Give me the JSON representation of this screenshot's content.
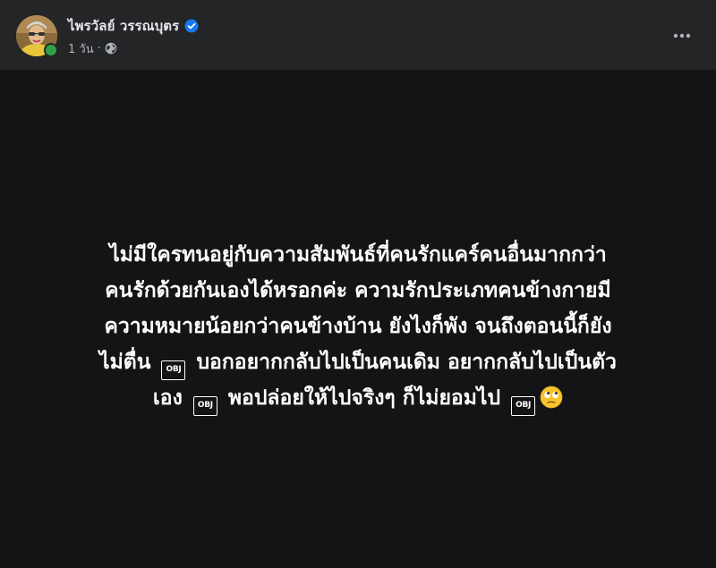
{
  "post": {
    "author": {
      "name": "ไพรวัลย์ วรรณบุตร",
      "verified": true,
      "online": true,
      "avatar_icon": "avatar-photo"
    },
    "meta": {
      "time": "1 วัน",
      "separator": "·",
      "audience_icon": "globe-icon"
    },
    "more_icon": "more-horizontal-icon",
    "body": {
      "background": "#141416",
      "lines": [
        {
          "parts": [
            {
              "type": "text",
              "value": "ไม่มีใครทนอยู่กับความสัมพันธ์ที่คนรักแคร์คนอื่นมากกว่า"
            }
          ]
        },
        {
          "parts": [
            {
              "type": "text",
              "value": "คนรักด้วยกันเองได้หรอกค่ะ ความรักประเภทคนข้างกายมี"
            }
          ]
        },
        {
          "parts": [
            {
              "type": "text",
              "value": "ความหมายน้อยกว่าคนข้างบ้าน ยังไงก็พัง จนถึงตอนนี้ก็ยัง"
            }
          ]
        },
        {
          "parts": [
            {
              "type": "text",
              "value": "ไม่ตื่น "
            },
            {
              "type": "obj",
              "value": "OBJ"
            },
            {
              "type": "text",
              "value": " บอกอยากกลับไปเป็นคนเดิม อยากกลับไปเป็นตัว"
            }
          ]
        },
        {
          "parts": [
            {
              "type": "text",
              "value": "เอง "
            },
            {
              "type": "obj",
              "value": "OBJ"
            },
            {
              "type": "text",
              "value": " พอปล่อยให้ไปจริงๆ ก็ไม่ยอมไป "
            },
            {
              "type": "obj",
              "value": "OBJ"
            },
            {
              "type": "emoji",
              "value": "face-with-rolling-eyes"
            }
          ]
        }
      ]
    }
  },
  "colors": {
    "header_bg": "#242526",
    "text_primary": "#e4e6eb",
    "text_secondary": "#b0b3b8",
    "verified_blue": "#1877f2",
    "online_green": "#31a24c"
  }
}
